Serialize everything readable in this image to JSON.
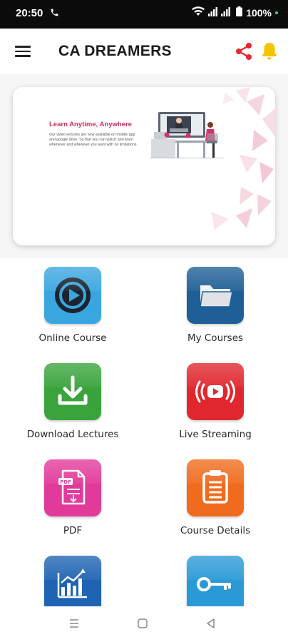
{
  "status_bar": {
    "time": "20:50",
    "battery": "100%",
    "icons": [
      "phone-icon",
      "wifi-icon",
      "signal-icon",
      "battery-icon"
    ]
  },
  "app_bar": {
    "title": "CA DREAMERS",
    "icons": [
      "menu-icon",
      "share-icon",
      "bell-icon"
    ],
    "accent_share": "#e8262f",
    "accent_bell": "#f5c400"
  },
  "banner": {
    "title": "Learn Anytime, Anywhere",
    "text": "Our video lectures are now available on mobile app and google drive. So that you can watch and learn whenever and wherever you want with no limitations."
  },
  "menu": [
    {
      "label": "Online Course",
      "icon": "play-circle-icon",
      "color": "#3aa6e0"
    },
    {
      "label": "My Courses",
      "icon": "folder-icon",
      "color": "#1f5f96"
    },
    {
      "label": "Download Lectures",
      "icon": "download-icon",
      "color": "#3aa33c"
    },
    {
      "label": "Live Streaming",
      "icon": "live-stream-icon",
      "color": "#e0272e"
    },
    {
      "label": "PDF",
      "icon": "pdf-icon",
      "color": "#e23a9a"
    },
    {
      "label": "Course Details",
      "icon": "clipboard-icon",
      "color": "#f06b1d"
    },
    {
      "label": "",
      "icon": "chart-icon",
      "color": "#1f64b3"
    },
    {
      "label": "",
      "icon": "key-icon",
      "color": "#2a9ad6"
    }
  ],
  "nav_bar": {
    "icons": [
      "recent-apps-icon",
      "home-icon",
      "back-icon"
    ]
  }
}
